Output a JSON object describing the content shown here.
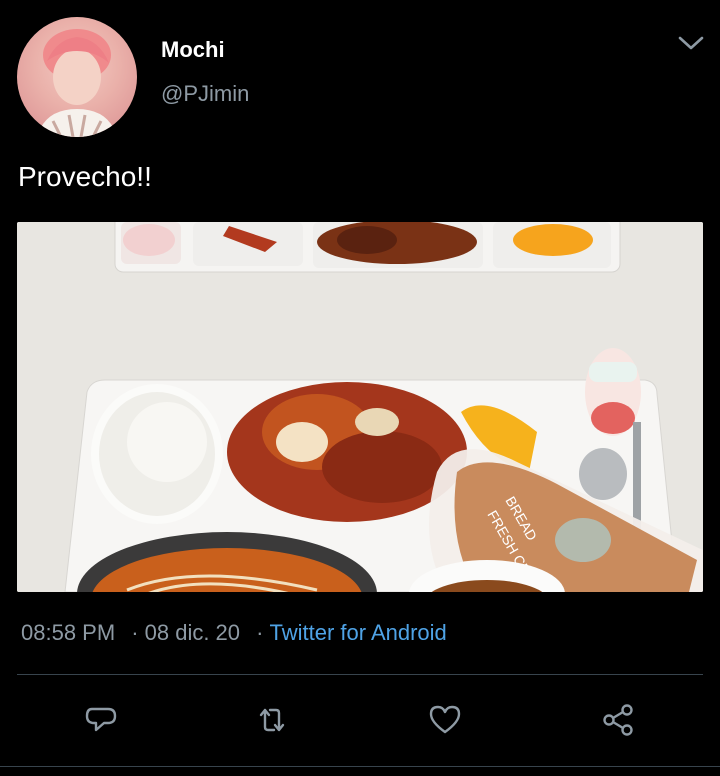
{
  "tweet": {
    "display_name": "Mochi",
    "handle": "@PJimin",
    "text": "Provecho!!",
    "time": "08:58 PM",
    "date": "08 dic. 20",
    "source": "Twitter for Android",
    "separator": "·"
  },
  "media": {
    "tray_labels": [
      "FRESH CREAM",
      "BREAD"
    ]
  },
  "colors": {
    "background": "#000000",
    "secondary_text": "#8e9aa4",
    "link": "#4fa3e6",
    "divider": "#38444d"
  },
  "icons": {
    "menu": "chevron-down-icon",
    "reply": "reply-icon",
    "retweet": "retweet-icon",
    "like": "heart-icon",
    "share": "share-icon"
  }
}
